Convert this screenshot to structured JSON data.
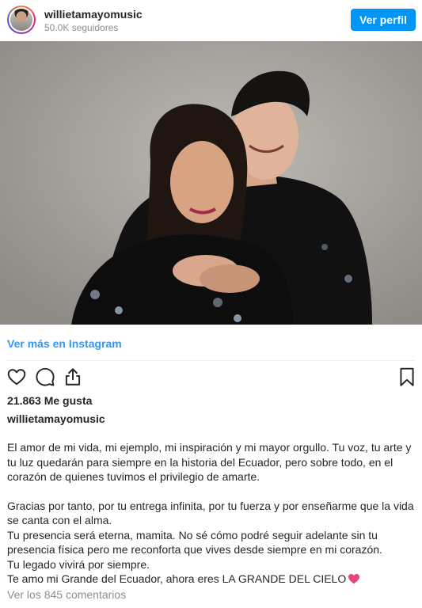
{
  "header": {
    "username": "willietamayomusic",
    "followers": "50.0K seguidores",
    "view_profile_label": "Ver perfil"
  },
  "post": {
    "image_alt": "willietamayomusic photo",
    "see_more_label": "Ver más en Instagram",
    "likes": "21.863 Me gusta",
    "owner": "willietamayomusic",
    "caption": {
      "line1": "El amor de mi vida, mi ejemplo, mi inspiración y mi mayor orgullo. Tu voz, tu arte y tu luz quedarán para siempre en la historia del Ecuador, pero sobre todo, en el corazón de quienes tuvimos el privilegio de amarte.",
      "line2": "Gracias por tanto, por tu entrega infinita, por tu fuerza y por enseñarme que la vida se canta con el alma.",
      "line3": "Tu presencia será eterna, mamita. No sé cómo podré seguir adelante sin tu presencia física pero me reconforta que vives desde siempre en mi corazón.",
      "line4": "Tu legado vivirá por siempre.",
      "line5": "Te amo mi Grande del Ecuador, ahora eres LA GRANDE DEL CIELO"
    },
    "comments_label": "Ver los 845 comentarios"
  },
  "icons": {
    "like": "heart-outline-icon",
    "comment": "comment-bubble-icon",
    "share": "share-icon",
    "save": "bookmark-icon",
    "emoji": "pink-heart-emoji"
  },
  "colors": {
    "accent": "#0095f6",
    "link": "#3897f0",
    "muted": "#8e8e8e",
    "emoji": "#e8457a"
  }
}
